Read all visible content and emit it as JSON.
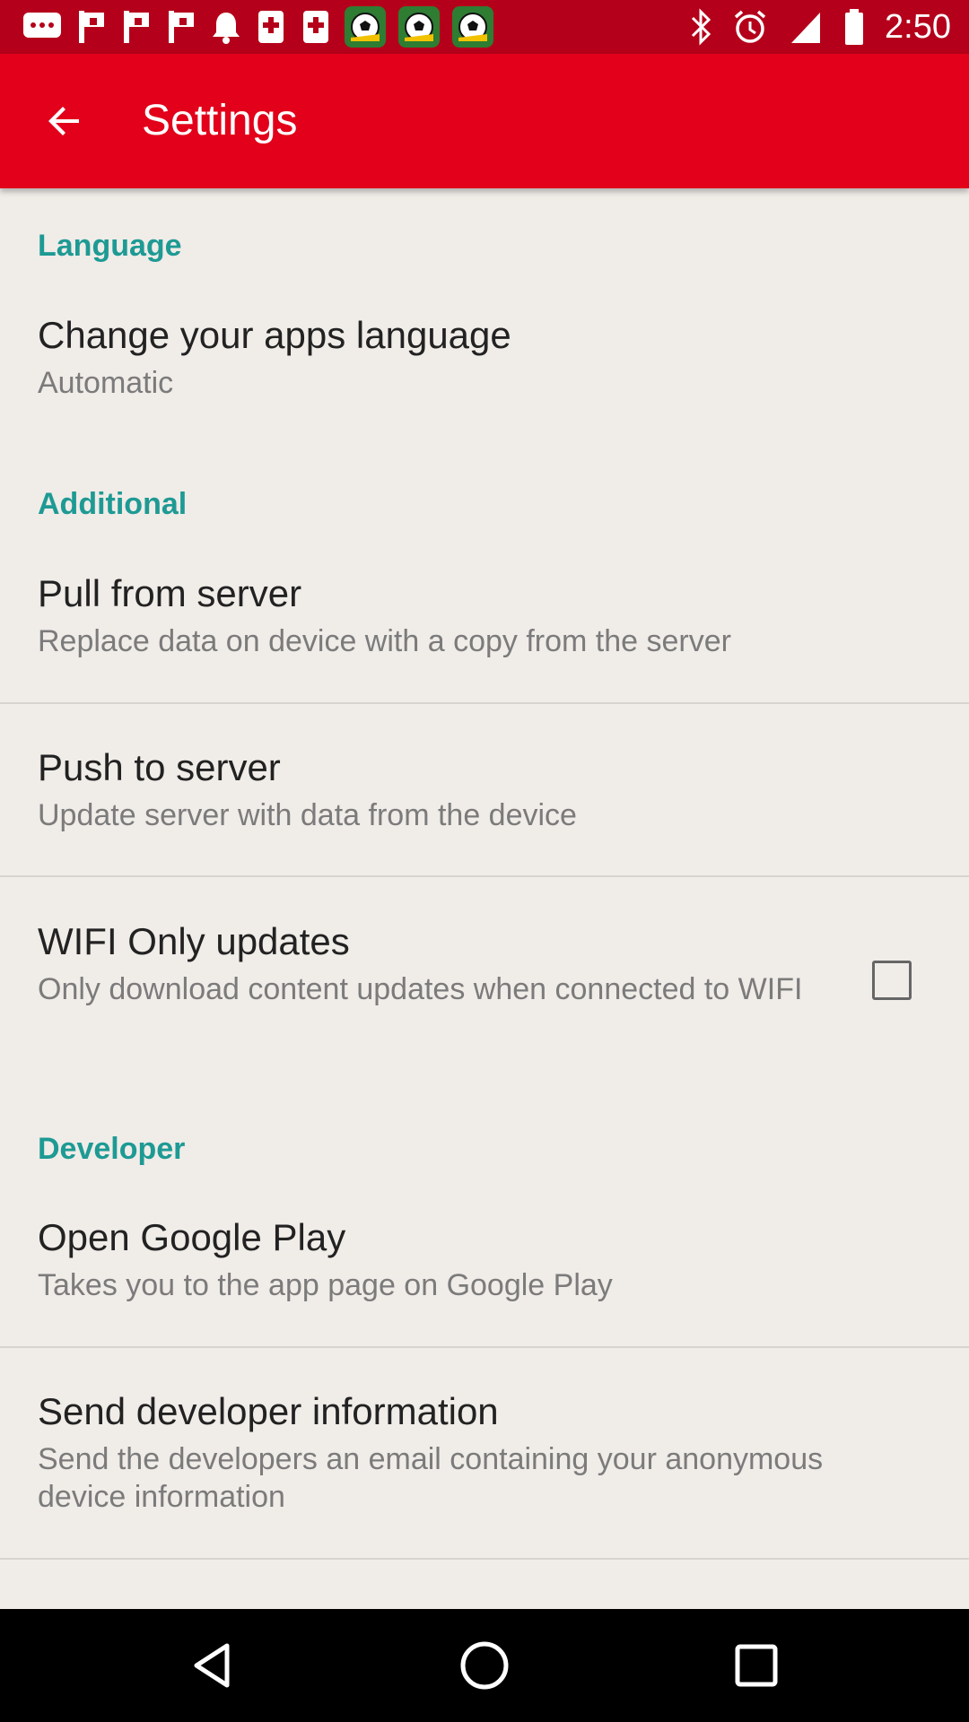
{
  "status_bar": {
    "time": "2:50",
    "icons": [
      "chat-icon",
      "flag-icon",
      "flag-icon",
      "flag-icon",
      "bell-icon",
      "tablet-icon",
      "tablet-icon",
      "soccer-ball-icon",
      "soccer-ball-icon",
      "soccer-ball-icon",
      "bluetooth-icon",
      "alarm-icon",
      "signal-icon",
      "battery-icon"
    ]
  },
  "app_bar": {
    "title": "Settings"
  },
  "sections": {
    "language": {
      "header": "Language",
      "change_language_title": "Change your apps language",
      "change_language_summary": "Automatic"
    },
    "additional": {
      "header": "Additional",
      "pull_title": "Pull from server",
      "pull_summary": "Replace data on device with a copy from the server",
      "push_title": "Push to server",
      "push_summary": "Update server with data from the device",
      "wifi_title": "WIFI Only updates",
      "wifi_summary": "Only download content updates when connected to WIFI",
      "wifi_checked": false
    },
    "developer": {
      "header": "Developer",
      "google_play_title": "Open Google Play",
      "google_play_summary": "Takes you to the app page on Google Play",
      "send_info_title": "Send developer information",
      "send_info_summary": "Send the developers an email containing your anonymous device information"
    }
  },
  "colors": {
    "status_bar": "#b4001a",
    "app_bar": "#e2001a",
    "category_header": "#1e9a94",
    "background": "#f0ece8"
  }
}
